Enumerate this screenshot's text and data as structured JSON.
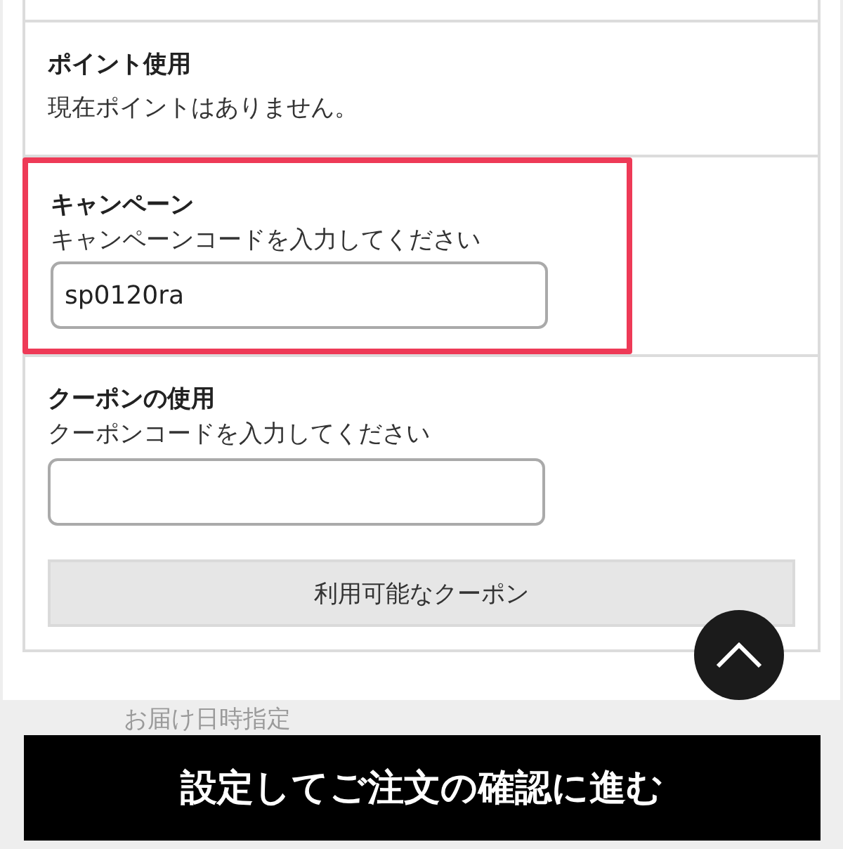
{
  "points": {
    "heading": "ポイント使用",
    "message": "現在ポイントはありません。"
  },
  "campaign": {
    "heading": "キャンペーン",
    "instruction": "キャンペーンコードを入力してください",
    "value": "sp0120ra",
    "highlighted": true
  },
  "coupon": {
    "heading": "クーポンの使用",
    "instruction": "クーポンコードを入力してください",
    "button": "利用可能なクーポン"
  },
  "next_section": {
    "heading": "お届け日時指定"
  },
  "submit_button": "設定してご注文の確認に進む"
}
